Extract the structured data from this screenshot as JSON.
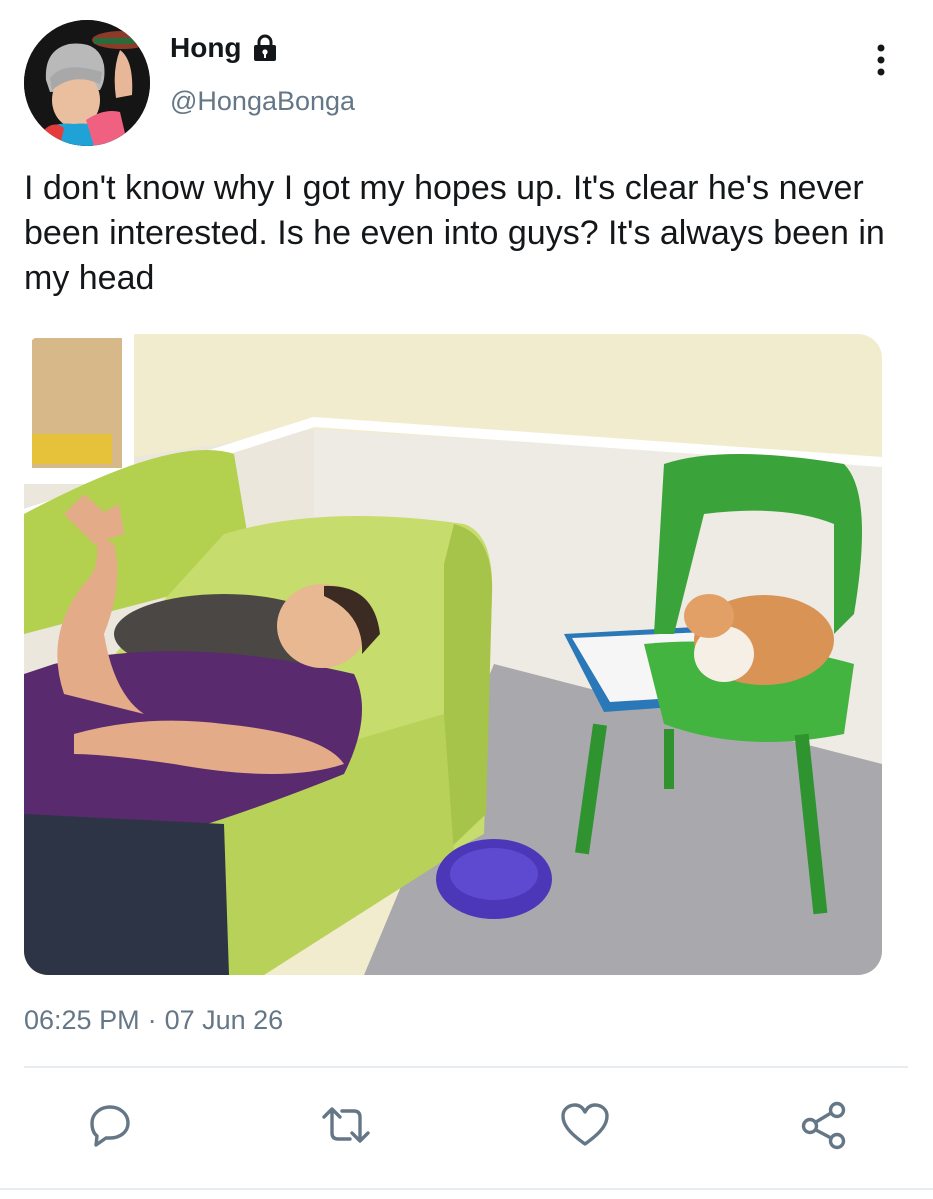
{
  "user": {
    "display_name": "Hong",
    "handle": "@HongaBonga",
    "protected_icon": "lock-icon"
  },
  "tweet": {
    "text": "I don't know why I got my hopes up. It's clear he's never been interested. Is he even into guys? It's always been in my head",
    "time": "06:25 PM",
    "separator": "·",
    "date": "07 Jun 26"
  },
  "actions": {
    "reply_icon": "reply-icon",
    "retweet_icon": "retweet-icon",
    "like_icon": "heart-icon",
    "share_icon": "share-icon"
  },
  "colors": {
    "text_primary": "#14171a",
    "text_secondary": "#657786",
    "icon": "#657786",
    "divider": "#e6ecf0"
  }
}
